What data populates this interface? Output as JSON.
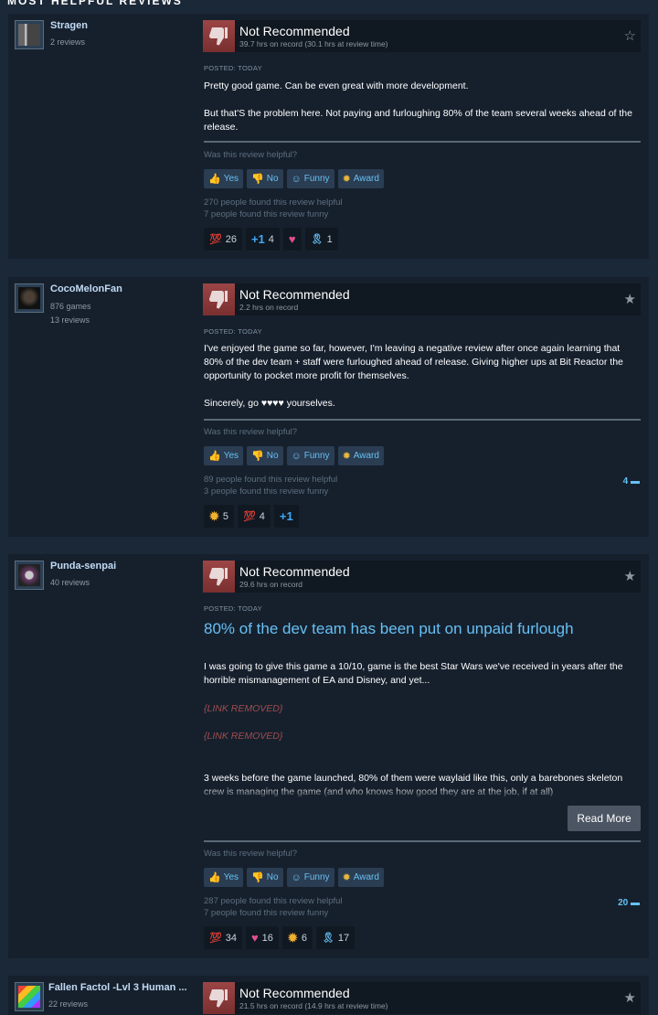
{
  "section_title": "MOST HELPFUL REVIEWS",
  "labels": {
    "helpful_question": "Was this review helpful?",
    "yes": "Yes",
    "no": "No",
    "funny": "Funny",
    "award": "Award",
    "read_more": "Read More",
    "not_recommended": "Not Recommended",
    "posted": "POSTED: TODAY"
  },
  "reviews": [
    {
      "author": "Stragen",
      "meta1": "2 reviews",
      "meta2": "",
      "hours": "39.7 hrs on record (30.1 hrs at review time)",
      "star": "☆",
      "paragraphs": [
        "Pretty good game. Can be even great with more development.",
        "But that'S the problem here. Not paying and furloughing 80% of the team several weeks ahead of the release."
      ],
      "found_helpful": "270 people found this review helpful",
      "found_funny": "7 people found this review funny",
      "comments": "",
      "awards": [
        {
          "icon": "100-icon",
          "glyph": "💯",
          "count": "26"
        },
        {
          "icon": "plus-one-icon",
          "glyph": "+1",
          "count": "4"
        },
        {
          "icon": "heart-hands-icon",
          "glyph": "♥",
          "count": ""
        },
        {
          "icon": "ribbon-icon",
          "glyph": "🎗",
          "count": "1"
        }
      ]
    },
    {
      "author": "CocoMelonFan",
      "meta1": "876 games",
      "meta2": "13 reviews",
      "hours": "2.2 hrs on record",
      "star": "★",
      "paragraphs": [
        "I've enjoyed the game so far, however, I'm leaving a negative review after once again learning that 80% of the dev team + staff were furloughed ahead of release. Giving higher ups at Bit Reactor the opportunity to pocket more profit for themselves.",
        "Sincerely, go ♥♥♥♥ yourselves."
      ],
      "found_helpful": "89 people found this review helpful",
      "found_funny": "3 people found this review funny",
      "comments": "4",
      "awards": [
        {
          "icon": "golden-award-icon",
          "glyph": "✹",
          "count": "5"
        },
        {
          "icon": "100-icon",
          "glyph": "💯",
          "count": "4"
        },
        {
          "icon": "plus-one-icon",
          "glyph": "+1",
          "count": ""
        }
      ]
    },
    {
      "author": "Punda-senpai",
      "meta1": "40 reviews",
      "meta2": "",
      "hours": "29.6 hrs on record",
      "star": "★",
      "headline": "80% of the dev team has been put on unpaid furlough",
      "paragraphs": [
        "I was going to give this game a 10/10, game is the best Star Wars we've received in years after the horrible mismanagement of EA and Disney, and yet...",
        "{LINK REMOVED}",
        "{LINK REMOVED}",
        "3 weeks before the game launched, 80% of them were waylaid like this, only a barebones skeleton crew is managing the game (and who knows how good they are at the job, if at all)"
      ],
      "found_helpful": "287 people found this review helpful",
      "found_funny": "7 people found this review funny",
      "comments": "20",
      "awards": [
        {
          "icon": "100-icon",
          "glyph": "💯",
          "count": "34"
        },
        {
          "icon": "heart-hands-icon",
          "glyph": "♥",
          "count": "16"
        },
        {
          "icon": "golden-award-icon",
          "glyph": "✹",
          "count": "6"
        },
        {
          "icon": "ribbon-icon",
          "glyph": "🎗",
          "count": "17"
        }
      ]
    },
    {
      "author": "Fallen Factol -Lvl 3 Human ...",
      "meta1": "22 reviews",
      "meta2": "",
      "hours": "21.5 hrs on record (14.9 hrs at review time)",
      "star": "★"
    }
  ],
  "colors": {
    "background": "#1b2838",
    "card": "#16202d",
    "accent": "#66c0f4",
    "thumb_down": "#8c3a3a"
  }
}
